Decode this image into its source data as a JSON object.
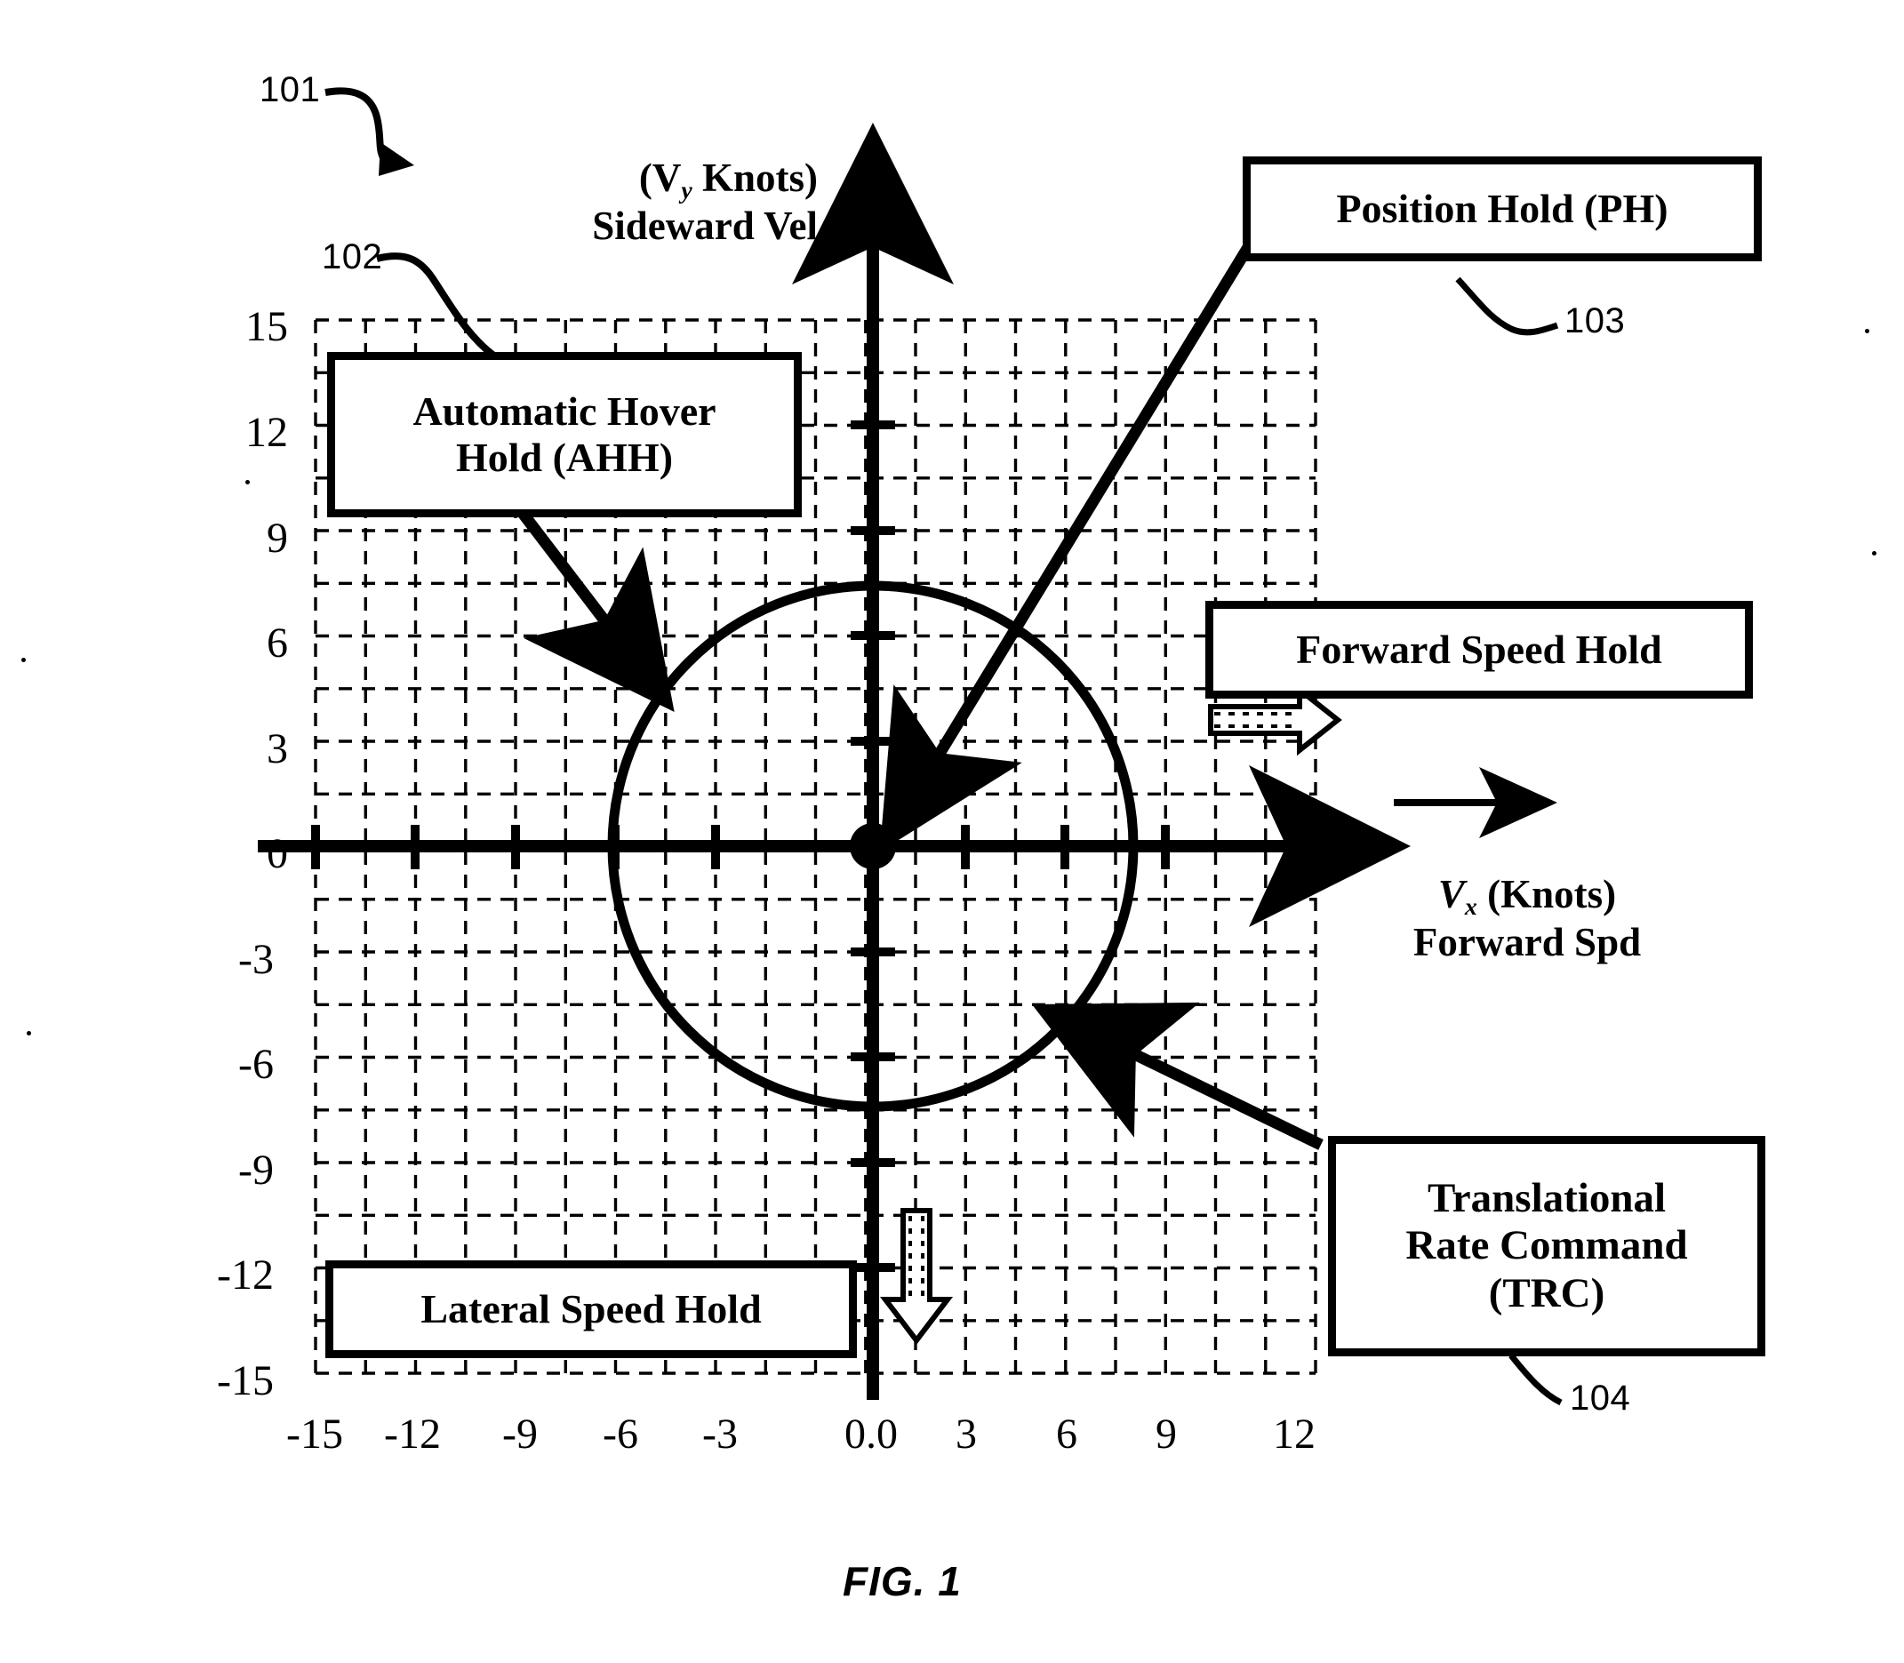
{
  "figure": {
    "caption": "FIG. 1",
    "reference_numbers": {
      "diagram": "101",
      "grid": "102",
      "position_hold": "103",
      "trc": "104"
    }
  },
  "axes": {
    "y": {
      "title_line1": "(V",
      "title_sub": "y",
      "title_line1_rest": " Knots)",
      "title_line2": "Sideward Vel",
      "full_title": "(Vy Knots) Sideward Vel",
      "ticks": [
        "15",
        "12",
        "9",
        "6",
        "3",
        "0",
        "-3",
        "-6",
        "-9",
        "-12",
        "-15"
      ],
      "tick_values": [
        15,
        12,
        9,
        6,
        3,
        0,
        -3,
        -6,
        -9,
        -12,
        -15
      ],
      "min": -15,
      "max": 15
    },
    "x": {
      "title_line1": "V",
      "title_sub": "x",
      "title_line1_rest": " (Knots)",
      "title_line2": "Forward Spd",
      "full_title": "Vx (Knots) Forward Spd",
      "ticks": [
        "-15",
        "-12",
        "-9",
        "-6",
        "-3",
        "0.0",
        "3",
        "6",
        "9",
        "12"
      ],
      "tick_values": [
        -15,
        -12,
        -9,
        -6,
        -3,
        0,
        3,
        6,
        9,
        12
      ],
      "min": -16,
      "max": 13
    }
  },
  "callouts": {
    "ahh": {
      "line1": "Automatic Hover",
      "line2": "Hold (AHH)",
      "label": "Automatic Hover Hold (AHH)"
    },
    "ph": {
      "line1": "Position Hold (PH)",
      "label": "Position Hold (PH)"
    },
    "fsh": {
      "line1": "Forward Speed Hold",
      "label": "Forward Speed Hold"
    },
    "lsh": {
      "line1": "Lateral Speed Hold",
      "label": "Lateral Speed Hold"
    },
    "trc": {
      "line1": "Translational",
      "line2": "Rate Command",
      "line3": "(TRC)",
      "label": "Translational Rate Command (TRC)"
    }
  },
  "colors": {
    "ink": "#000000",
    "paper": "#ffffff"
  },
  "chart_data": {
    "type": "scatter",
    "title": "FIG. 1",
    "xlabel": "Vx (Knots) Forward Spd",
    "ylabel": "(Vy Knots) Sideward Vel",
    "xlim": [
      -16,
      13
    ],
    "ylim": [
      -15.5,
      15.5
    ],
    "grid": true,
    "grid_style": "dashed",
    "grid_spacing": 1.5,
    "xticks": [
      -15,
      -12,
      -9,
      -6,
      -3,
      0,
      3,
      6,
      9,
      12
    ],
    "xticklabels": [
      "-15",
      "-12",
      "-9",
      "-6",
      "-3",
      "0.0",
      "3",
      "6",
      "9",
      "12"
    ],
    "yticks": [
      -15,
      -12,
      -9,
      -6,
      -3,
      0,
      3,
      6,
      9,
      12,
      15
    ],
    "yticklabels": [
      "-15",
      "-12",
      "-9",
      "-6",
      "-3",
      "0",
      "3",
      "6",
      "9",
      "12",
      "15"
    ],
    "legend": "none",
    "annotations": [
      {
        "text": "Automatic Hover Hold (AHH)",
        "points_to": [
          -1.2,
          4.3
        ]
      },
      {
        "text": "Position Hold (PH)",
        "points_to": [
          -0.4,
          0.6
        ]
      },
      {
        "text": "Forward Speed Hold",
        "points_to": [
          12.4,
          4.2
        ]
      },
      {
        "text": "Lateral Speed Hold",
        "points_to": [
          0.8,
          -14.4
        ]
      },
      {
        "text": "Translational Rate Command (TRC)",
        "points_to": [
          4.8,
          -5.2
        ]
      },
      {
        "text": "101",
        "points_to": [
          -12.5,
          16.8
        ]
      },
      {
        "text": "102",
        "points_to": [
          -10.0,
          15.2
        ]
      },
      {
        "text": "103",
        "points_to": [
          null,
          null
        ]
      },
      {
        "text": "104",
        "points_to": [
          null,
          null
        ]
      }
    ],
    "series": [
      {
        "name": "hover envelope circle",
        "type": "circle",
        "center": [
          0.0,
          0.0
        ],
        "radius": 10.0,
        "note": "bold solid circle denoting the AHH / TRC velocity envelope"
      },
      {
        "name": "origin marker",
        "type": "point",
        "values": [
          [
            0.0,
            0.0
          ]
        ],
        "note": "filled dot at origin indicating Position Hold"
      }
    ]
  }
}
